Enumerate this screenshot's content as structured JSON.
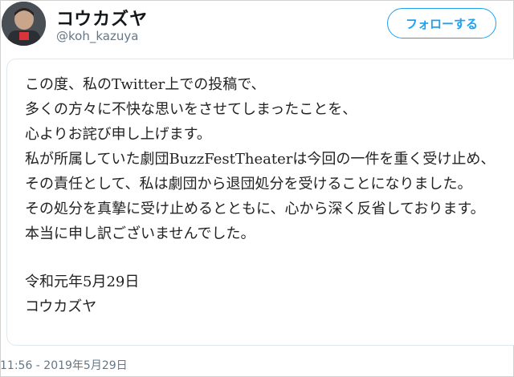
{
  "user": {
    "display_name": "コウカズヤ",
    "handle": "@koh_kazuya"
  },
  "follow_button": {
    "label": "フォローする"
  },
  "statement": {
    "body_lines": [
      "この度、私のTwitter上での投稿で、",
      "多くの方々に不快な思いをさせてしまったことを、",
      "心よりお詫び申し上げます。",
      "私が所属していた劇団BuzzFestTheaterは今回の一件を重く受け止め、",
      "その責任として、私は劇団から退団処分を受けることになりました。",
      "その処分を真摯に受け止めるとともに、心から深く反省しております。",
      "本当に申し訳ございませんでした。"
    ],
    "date": "令和元年5月29日",
    "signature": "コウカズヤ"
  },
  "tweet": {
    "timestamp": "11:56 - 2019年5月29日"
  },
  "colors": {
    "accent": "#1da1f2",
    "secondary_text": "#657786"
  }
}
